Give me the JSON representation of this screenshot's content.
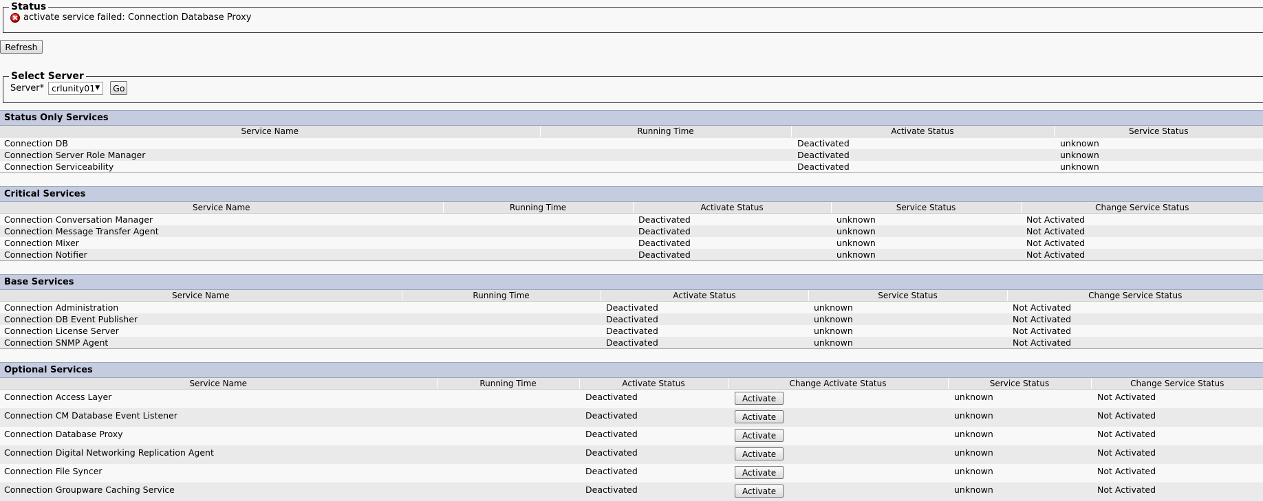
{
  "status": {
    "legend": "Status",
    "message": "activate service failed: Connection Database Proxy"
  },
  "refresh_label": "Refresh",
  "server": {
    "legend": "Select Server",
    "label": "Server*",
    "selected": "crlunity01",
    "go_label": "Go"
  },
  "status_only": {
    "title": "Status Only Services",
    "headers": [
      "Service Name",
      "Running Time",
      "Activate Status",
      "Service Status"
    ],
    "rows": [
      [
        "Connection DB",
        "",
        "Deactivated",
        "unknown"
      ],
      [
        "Connection Server Role Manager",
        "",
        "Deactivated",
        "unknown"
      ],
      [
        "Connection Serviceability",
        "",
        "Deactivated",
        "unknown"
      ]
    ]
  },
  "critical": {
    "title": "Critical Services",
    "headers": [
      "Service Name",
      "Running Time",
      "Activate Status",
      "Service Status",
      "Change Service Status"
    ],
    "rows": [
      [
        "Connection Conversation Manager",
        "",
        "Deactivated",
        "unknown",
        "Not Activated"
      ],
      [
        "Connection Message Transfer Agent",
        "",
        "Deactivated",
        "unknown",
        "Not Activated"
      ],
      [
        "Connection Mixer",
        "",
        "Deactivated",
        "unknown",
        "Not Activated"
      ],
      [
        "Connection Notifier",
        "",
        "Deactivated",
        "unknown",
        "Not Activated"
      ]
    ]
  },
  "base": {
    "title": "Base Services",
    "headers": [
      "Service Name",
      "Running Time",
      "Activate Status",
      "Service Status",
      "Change Service Status"
    ],
    "rows": [
      [
        "Connection Administration",
        "",
        "Deactivated",
        "unknown",
        "Not Activated"
      ],
      [
        "Connection DB Event Publisher",
        "",
        "Deactivated",
        "unknown",
        "Not Activated"
      ],
      [
        "Connection License Server",
        "",
        "Deactivated",
        "unknown",
        "Not Activated"
      ],
      [
        "Connection SNMP Agent",
        "",
        "Deactivated",
        "unknown",
        "Not Activated"
      ]
    ]
  },
  "optional": {
    "title": "Optional Services",
    "headers": [
      "Service Name",
      "Running Time",
      "Activate Status",
      "Change Activate Status",
      "Service Status",
      "Change Service Status"
    ],
    "activate_label": "Activate",
    "rows": [
      [
        "Connection Access Layer",
        "",
        "Deactivated",
        "Activate",
        "unknown",
        "Not Activated"
      ],
      [
        "Connection CM Database Event Listener",
        "",
        "Deactivated",
        "Activate",
        "unknown",
        "Not Activated"
      ],
      [
        "Connection Database Proxy",
        "",
        "Deactivated",
        "Activate",
        "unknown",
        "Not Activated"
      ],
      [
        "Connection Digital Networking Replication Agent",
        "",
        "Deactivated",
        "Activate",
        "unknown",
        "Not Activated"
      ],
      [
        "Connection File Syncer",
        "",
        "Deactivated",
        "Activate",
        "unknown",
        "Not Activated"
      ],
      [
        "Connection Groupware Caching Service",
        "",
        "Deactivated",
        "Activate",
        "unknown",
        "Not Activated"
      ]
    ]
  }
}
